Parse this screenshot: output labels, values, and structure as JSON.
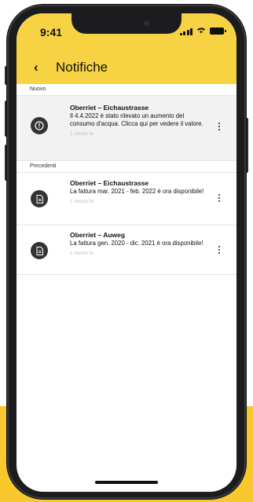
{
  "status_bar": {
    "time": "9:41"
  },
  "header": {
    "back_icon": "back-arrow-icon",
    "title": "Notifiche"
  },
  "sections": {
    "new_label": "Nuovo",
    "previous_label": "Precedenti"
  },
  "notifications": [
    {
      "icon": "alert-icon",
      "title": "Oberriet – Eichaustrasse",
      "body": "Il 4.4.2022 è stato rilevato un aumento del consumo d'acqua. Clicca qui per vedere il valore.",
      "time": "1 minuto fa",
      "unread": true
    },
    {
      "icon": "document-icon",
      "title": "Oberriet – Eichaustrasse",
      "body": "La fattura mar. 2021 - feb. 2022 è ora disponibile!",
      "time": "1 minuto fa",
      "unread": false
    },
    {
      "icon": "document-icon",
      "title": "Oberriet – Auweg",
      "body": "La fattura gen. 2020 - dic. 2021 è ora disponibile!",
      "time": "1 minuto fa",
      "unread": false
    }
  ],
  "colors": {
    "accent": "#f7d243",
    "background_accent": "#f7c92f",
    "icon_bg": "#333333"
  }
}
